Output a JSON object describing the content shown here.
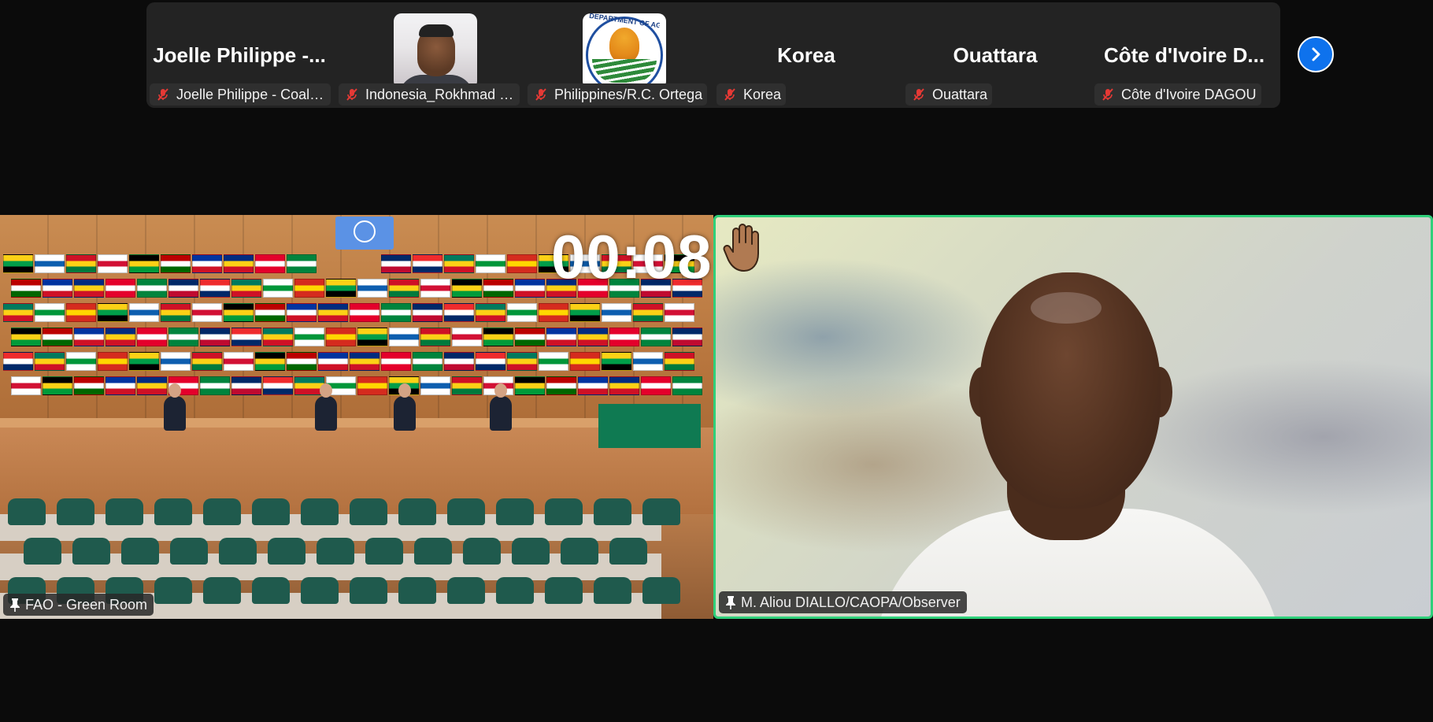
{
  "participants": [
    {
      "display": "Joelle Philippe -...",
      "tag": "Joelle Philippe - Coalit...",
      "muted": true,
      "video": "name"
    },
    {
      "display": "",
      "tag": "Indonesia_Rokhmad R...",
      "muted": true,
      "video": "person"
    },
    {
      "display": "",
      "tag": "Philippines/R.C. Ortega",
      "muted": true,
      "video": "logo",
      "logo_text": "DEPARTMENT OF AGRICULTURE"
    },
    {
      "display": "Korea",
      "tag": "Korea",
      "muted": true,
      "video": "name"
    },
    {
      "display": "Ouattara",
      "tag": "Ouattara",
      "muted": true,
      "video": "name"
    },
    {
      "display": "Côte d'Ivoire D...",
      "tag": "Côte d'Ivoire DAGOU",
      "muted": true,
      "video": "name"
    }
  ],
  "next_page_icon": "chevron-right-icon",
  "main_left": {
    "label": "FAO - Green Room",
    "timer": "00:08",
    "pinned": true
  },
  "main_right": {
    "label": "M. Aliou DIALLO/CAOPA/Observer",
    "pinned": true,
    "hand_raised": true,
    "active_speaker_color": "#2fd07a"
  },
  "colors": {
    "background": "#0b0b0b",
    "strip": "#232323",
    "accent": "#0e72ed",
    "muted": "#e53935"
  }
}
